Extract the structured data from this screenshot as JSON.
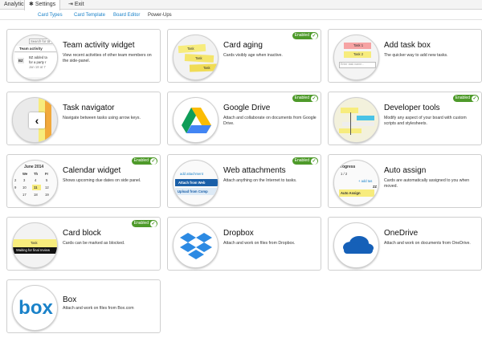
{
  "topbar": {
    "analytics": "Analytics",
    "settings": "Settings",
    "settings_icon": "gear-icon",
    "exit": "Exit",
    "exit_icon": "exit-icon"
  },
  "subnav": {
    "items": [
      "Card Types",
      "Card Template",
      "Board Editor",
      "Power-Ups"
    ],
    "active": "Power-Ups"
  },
  "colors": {
    "link": "#1a82c9",
    "enabled": "#4e9a2a",
    "sticky": "#f7ec7d",
    "dropbox": "#2c8ae3",
    "onedrive": "#1560b8",
    "box": "#1a82c9"
  },
  "badge_label": "Enabled",
  "powerups": [
    {
      "id": "team-activity-widget",
      "title": "Team activity widget",
      "desc": "View recent activities of other team members on the side-panel.",
      "enabled": false,
      "art": {
        "search": "Search for ta",
        "header": "Team activity",
        "initials": "BZ",
        "line1": "BZ added ta",
        "line2": "for a party r",
        "date": "Jan 18 at 7"
      }
    },
    {
      "id": "card-aging",
      "title": "Card aging",
      "desc": "Cards visibly age when inactive.",
      "enabled": true,
      "art": {
        "cards": [
          "Task",
          "Task",
          "Task"
        ]
      }
    },
    {
      "id": "add-task-box",
      "title": "Add task box",
      "desc": "The quicker way to add new tasks.",
      "enabled": false,
      "art": {
        "cards": [
          "Task 1",
          "Task 2"
        ],
        "placeholder": "Enter task name..."
      }
    },
    {
      "id": "task-navigator",
      "title": "Task navigator",
      "desc": "Navigate between tasks using arrow keys.",
      "enabled": false,
      "art": {
        "icon": "chevron-left-icon"
      }
    },
    {
      "id": "google-drive",
      "title": "Google Drive",
      "desc": "Attach and collaborate on documents from Google Drive.",
      "enabled": true,
      "art": {
        "icon": "google-drive-icon"
      }
    },
    {
      "id": "developer-tools",
      "title": "Developer tools",
      "desc": "Modify any aspect of your board with custom scripts and stylesheets.",
      "enabled": true,
      "art": {
        "icon": "developer-tools-icon"
      }
    },
    {
      "id": "calendar-widget",
      "title": "Calendar widget",
      "desc": "Shows upcoming due dates on side panel.",
      "enabled": true,
      "art": {
        "month": "June 2014",
        "days": [
          "We",
          "Th",
          "Fr"
        ],
        "rows": [
          [
            "2",
            "3",
            "4",
            "5"
          ],
          [
            "9",
            "10",
            "11",
            "12"
          ],
          [
            "",
            "17",
            "18",
            "19"
          ]
        ]
      }
    },
    {
      "id": "web-attachments",
      "title": "Web attachments",
      "desc": "Attach anything on the Internet to tasks.",
      "enabled": true,
      "art": {
        "link": "add attachment",
        "btn1": "Attach from Web",
        "btn2": "Upload from Comp"
      }
    },
    {
      "id": "auto-assign",
      "title": "Auto assign",
      "desc": "Cards are automatically assigned to you when moved.",
      "enabled": false,
      "art": {
        "header": "rogress",
        "count": "1 / 2",
        "add": "+ add tas",
        "initials": "ZZ",
        "card": "Auto Assign"
      }
    },
    {
      "id": "card-block",
      "title": "Card block",
      "desc": "Cards can be marked as blocked.",
      "enabled": true,
      "art": {
        "card": "Task",
        "status": "Waiting for final review"
      }
    },
    {
      "id": "dropbox",
      "title": "Dropbox",
      "desc": "Attach and work on files from Dropbox.",
      "enabled": false,
      "art": {
        "icon": "dropbox-icon"
      }
    },
    {
      "id": "onedrive",
      "title": "OneDrive",
      "desc": "Attach and work on documents from OneDrive.",
      "enabled": false,
      "art": {
        "icon": "onedrive-icon"
      }
    },
    {
      "id": "box",
      "title": "Box",
      "desc": "Attach and work on files from Box.com",
      "enabled": false,
      "art": {
        "logo": "box"
      }
    }
  ]
}
